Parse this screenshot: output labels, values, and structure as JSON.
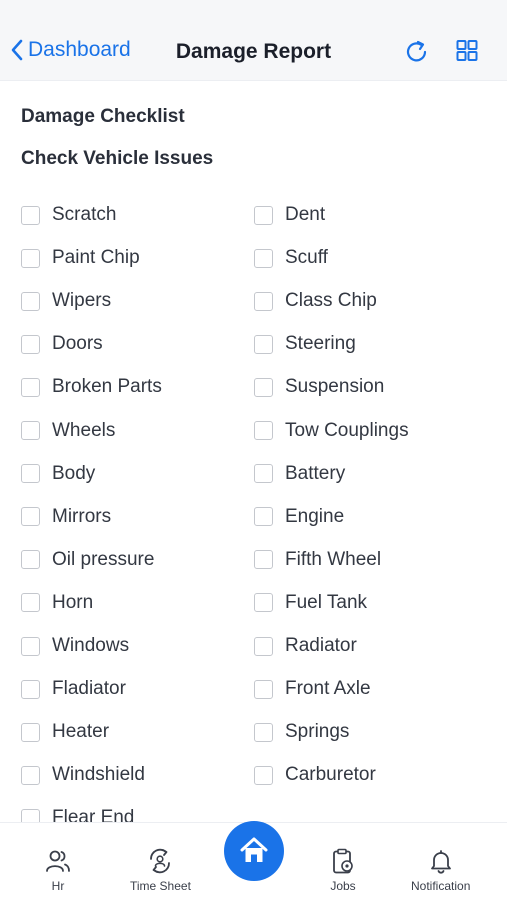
{
  "header": {
    "back_label": "Dashboard",
    "title": "Damage Report"
  },
  "sections": {
    "damage_checklist": "Damage Checklist",
    "check_vehicle_issues": "Check Vehicle Issues"
  },
  "checklist": {
    "left": [
      "Scratch",
      "Paint Chip",
      "Wipers",
      "Doors",
      "Broken Parts",
      "Wheels",
      "Body",
      "Mirrors",
      "Oil pressure",
      "Horn",
      "Windows",
      "Fladiator",
      "Heater",
      "Windshield",
      "Flear End"
    ],
    "right": [
      "Dent",
      "Scuff",
      "Class Chip",
      "Steering",
      "Suspension",
      "Tow Couplings",
      "Battery",
      "Engine",
      "Fifth Wheel",
      "Fuel Tank",
      "Radiator",
      "Front Axle",
      "Springs",
      "Carburetor"
    ]
  },
  "tabbar": {
    "hr": "Hr",
    "timesheet": "Time Sheet",
    "jobs": "Jobs",
    "notification": "Notification"
  },
  "colors": {
    "accent": "#1a73e8",
    "header_bg": "#f6f7f9",
    "checkbox_border": "#c4c7cd"
  },
  "icons": {
    "back": "chevron-left-icon",
    "refresh": "refresh-icon",
    "grid": "grid-icon",
    "hr": "people-icon",
    "timesheet": "timesheet-icon",
    "home": "home-icon",
    "jobs": "clipboard-icon",
    "notification": "bell-icon"
  }
}
